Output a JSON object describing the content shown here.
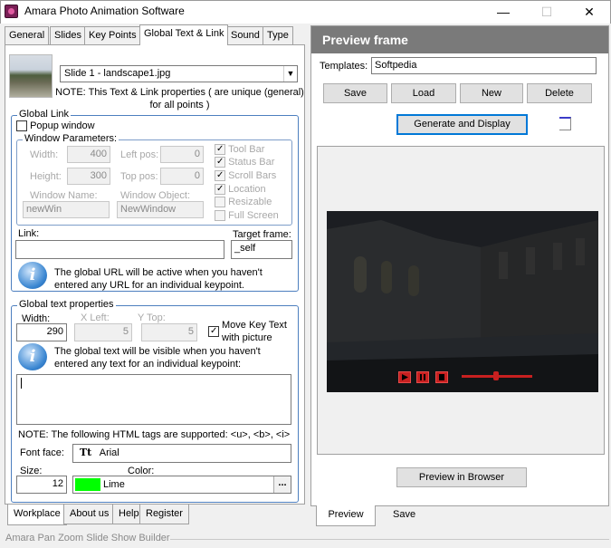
{
  "window": {
    "title": "Amara Photo Animation Software",
    "minimize_glyph": "—",
    "maximize_glyph": "☐",
    "close_glyph": "✕"
  },
  "tabs": [
    "General",
    "Slides",
    "Key Points",
    "Global Text & Link",
    "Sound",
    "Type"
  ],
  "slide": {
    "selected": "Slide 1 - landscape1.jpg",
    "note": "NOTE: This Text & Link properties ( are unique (general) for all points )"
  },
  "global_link": {
    "title": "Global Link",
    "popup_label": "Popup window",
    "window_params": {
      "title": "Window Parameters:",
      "width_label": "Width:",
      "width_value": "400",
      "left_label": "Left pos:",
      "left_value": "0",
      "height_label": "Height:",
      "height_value": "300",
      "top_label": "Top pos:",
      "top_value": "0",
      "window_name_label": "Window Name:",
      "window_name_value": "newWin",
      "window_object_label": "Window Object:",
      "window_object_value": "NewWindow",
      "options": [
        {
          "label": "Tool Bar",
          "checked": true
        },
        {
          "label": "Status Bar",
          "checked": true
        },
        {
          "label": "Scroll Bars",
          "checked": true
        },
        {
          "label": "Location",
          "checked": true
        },
        {
          "label": "Resizable",
          "checked": false
        },
        {
          "label": "Full Screen",
          "checked": false
        }
      ]
    },
    "link_label": "Link:",
    "link_value": "",
    "target_label": "Target frame:",
    "target_value": "_self",
    "info": "The global URL will be active when you haven't entered any URL for an individual keypoint."
  },
  "global_text": {
    "title": "Global text properties",
    "width_label": "Width:",
    "width_value": "290",
    "xleft_label": "X Left:",
    "xleft_value": "5",
    "ytop_label": "Y Top:",
    "ytop_value": "5",
    "move_label": "Move Key Text with picture",
    "info": "The global text will be visible when you haven't entered any text for an individual keypoint:",
    "text_value": "",
    "html_note": "NOTE: The following HTML tags are supported: <u>, <b>, <i>",
    "font_face_label": "Font face:",
    "font_face_value": "Arial",
    "size_label": "Size:",
    "size_value": "12",
    "color_label": "Color:",
    "color_value": "Lime",
    "color_hex": "#00ff00",
    "ellipsis": "..."
  },
  "left_bottom_tabs": [
    "Workplace",
    "About us",
    "Help",
    "Register"
  ],
  "preview": {
    "header": "Preview frame",
    "templates_label": "Templates:",
    "templates_value": "Softpedia",
    "buttons": [
      "Save",
      "Load",
      "New",
      "Delete"
    ],
    "generate_label": "Generate and Display",
    "preview_browser_label": "Preview in Browser",
    "bottom_tabs": [
      "Preview",
      "Save"
    ]
  },
  "status": "Amara Pan Zoom Slide Show Builder"
}
